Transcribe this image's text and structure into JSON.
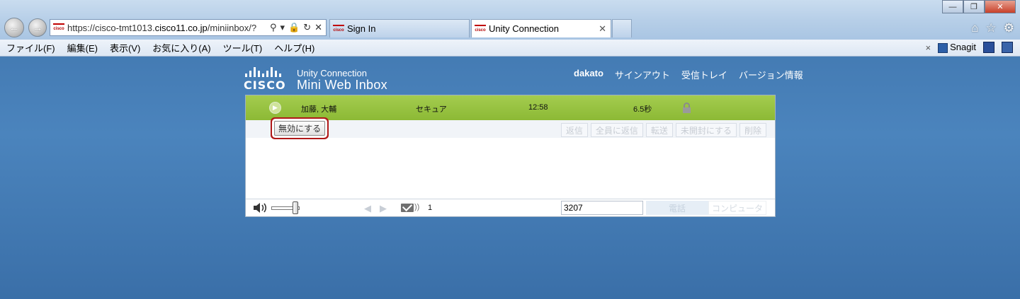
{
  "browser": {
    "address": {
      "scheme": "https://",
      "host_prefix": "cisco-tmt1013.",
      "host_main": "cisco11.co.jp",
      "path": "/miniinbox/?"
    },
    "tabs": [
      {
        "label": "Sign In",
        "active": false
      },
      {
        "label": "Unity Connection",
        "active": true
      }
    ],
    "favicon_text": "cisco",
    "menu": [
      "ファイル(F)",
      "編集(E)",
      "表示(V)",
      "お気に入り(A)",
      "ツール(T)",
      "ヘルプ(H)"
    ],
    "toolbar_right": {
      "close": "×",
      "snagit": "Snagit"
    },
    "window_buttons": {
      "minimize": "—",
      "restore": "❐",
      "close": "✕"
    }
  },
  "app": {
    "logo_text": "CISCO",
    "subtitle": "Unity Connection",
    "title": "Mini Web Inbox",
    "user": "dakato",
    "links": [
      "サインアウト",
      "受信トレイ",
      "バージョン情報"
    ]
  },
  "message": {
    "sender": "加藤, 大輔",
    "type": "セキュア",
    "time": "12:58",
    "duration": "6.5秒"
  },
  "actions": {
    "disable": "無効にする",
    "buttons": [
      "返信",
      "全員に返信",
      "転送",
      "未開封にする",
      "削除"
    ]
  },
  "player": {
    "volume_level": 0.85,
    "message_count": "1",
    "phone_number": "3207",
    "phone_button": "電話",
    "computer_button": "コンピュータ"
  },
  "colors": {
    "message_row": "#9cc443",
    "highlight_border": "#b01818",
    "background": "#4178b3"
  }
}
